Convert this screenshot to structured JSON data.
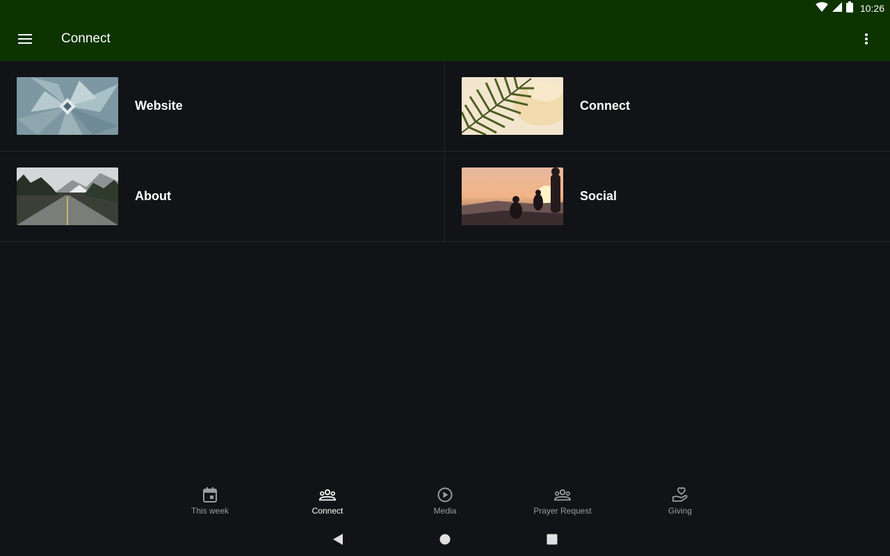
{
  "status_bar": {
    "time": "10:26",
    "icons": [
      "wifi-icon",
      "signal-icon",
      "battery-icon"
    ]
  },
  "app_bar": {
    "title": "Connect",
    "menu_icon": "hamburger-menu-icon",
    "overflow_icon": "more-vertical-icon",
    "color": "#0d3300"
  },
  "tiles": [
    {
      "label": "Website",
      "image": "agave-plant-image"
    },
    {
      "label": "Connect",
      "image": "palm-leaf-image"
    },
    {
      "label": "About",
      "image": "mountain-road-image"
    },
    {
      "label": "Social",
      "image": "sunset-people-image"
    }
  ],
  "bottom_nav": {
    "active_index": 1,
    "items": [
      {
        "label": "This week",
        "icon": "calendar-icon"
      },
      {
        "label": "Connect",
        "icon": "group-icon"
      },
      {
        "label": "Media",
        "icon": "play-circle-icon"
      },
      {
        "label": "Prayer Request",
        "icon": "group-icon"
      },
      {
        "label": "Giving",
        "icon": "hand-heart-icon"
      }
    ]
  },
  "system_nav": [
    "back-icon",
    "home-icon",
    "recents-icon"
  ],
  "colors": {
    "background": "#121316",
    "divider": "#24262a",
    "inactive_nav": "#9a9ca0"
  }
}
